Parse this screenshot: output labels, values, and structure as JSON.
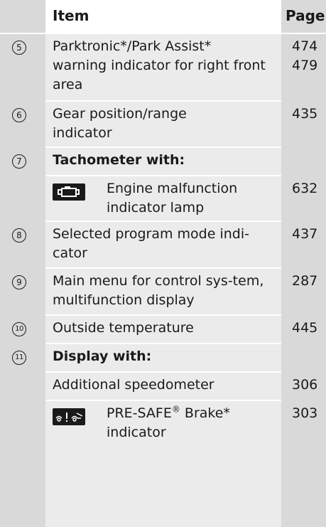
{
  "header": {
    "item_label": "Item",
    "page_label": "Page"
  },
  "rows": [
    {
      "num": "5",
      "text": "Parktronic*/Park Assist* warning indicator for right front area",
      "pages": "474\n479"
    },
    {
      "num": "6",
      "text": "Gear position/range indicator",
      "pages": "435"
    },
    {
      "num": "7",
      "text": "Tachometer with:",
      "pages": ""
    },
    {
      "icon": "engine-malfunction-icon",
      "text": "Engine malfunction indicator lamp",
      "pages": "632"
    },
    {
      "num": "8",
      "text": "Selected program mode indi-cator",
      "pages": "437"
    },
    {
      "num": "9",
      "text": "Main menu for control sys-tem, multifunction display",
      "pages": "287"
    },
    {
      "num": "10",
      "text": "Outside temperature",
      "pages": "445"
    },
    {
      "num": "11",
      "text": "Display with:",
      "pages": ""
    },
    {
      "text": "Additional speedometer",
      "pages": "306"
    },
    {
      "icon": "pre-safe-brake-icon",
      "text_before": "PRE-SAFE",
      "sup": "®",
      "text_after": " Brake* indicator",
      "pages": "303"
    }
  ],
  "colors": {
    "band": "#d9d9d9",
    "row_shade": "#ebebeb",
    "text": "#1a1a1a"
  }
}
